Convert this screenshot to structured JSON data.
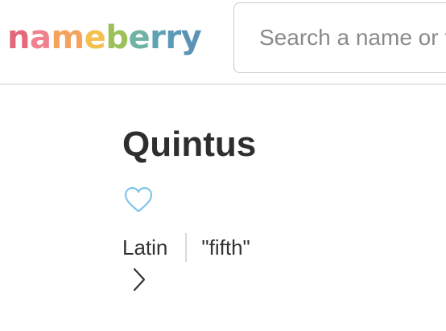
{
  "header": {
    "logo_letters": [
      "n",
      "a",
      "m",
      "e",
      "b",
      "e",
      "r",
      "r",
      "y"
    ],
    "logo_colors": [
      "#e4687a",
      "#f0828f",
      "#f5a25d",
      "#f4c04f",
      "#9cc15b",
      "#6fb3a5",
      "#5fa3b3",
      "#5b9bb8",
      "#5a93b5"
    ],
    "search_placeholder": "Search a name or topic"
  },
  "name": {
    "title": "Quintus",
    "origin": "Latin",
    "meaning": "\"fifth\""
  },
  "colors": {
    "heart": "#7fc6e8",
    "text": "#333333"
  },
  "icons": {
    "favorite": "heart-outline-icon",
    "expand": "chevron-right-icon"
  }
}
